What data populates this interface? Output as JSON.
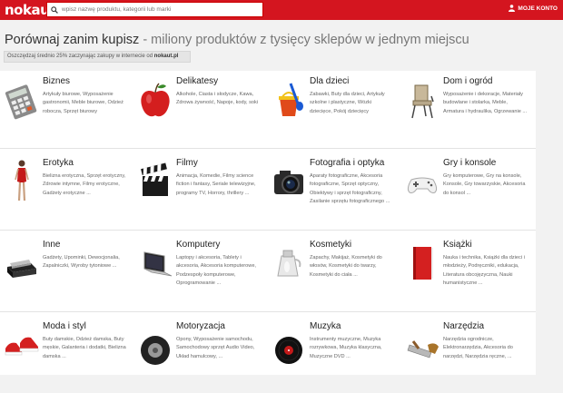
{
  "header": {
    "logo": "nokaut",
    "search_placeholder": "wpisz nazwę produktu, kategorii lub marki",
    "account_label": "MOJE KONTO"
  },
  "headline": {
    "strong": "Porównaj zanim kupisz",
    "light": " - miliony produktów z tysięcy sklepów w jednym miejscu"
  },
  "promo": {
    "text": "Oszczędzaj średnio 25% zaczynając zakupy w internecie od ",
    "brand": "nokaut.pl"
  },
  "categories": [
    {
      "title": "Biznes",
      "desc": "Artykuły biurowe, Wyposażenie gastronomii, Meble biurowe, Odzież robocza, Sprzęt biurowy",
      "icon": "calculator-icon"
    },
    {
      "title": "Delikatesy",
      "desc": "Alkohole, Ciasta i słodycze, Kawa, Zdrowa żywność, Napoje, kody, soki",
      "icon": "apple-icon"
    },
    {
      "title": "Dla dzieci",
      "desc": "Zabawki, Buty dla dzieci, Artykuły szkolne i plastyczne, Wózki dziecięce, Pokój dziecięcy",
      "icon": "bucket-toy-icon"
    },
    {
      "title": "Dom i ogród",
      "desc": "Wyposażenie i dekoracje, Materiały budowlane i stolarka, Meble, Armatura i hydraulika, Ogrzewanie ...",
      "icon": "chair-icon"
    },
    {
      "title": "Erotyka",
      "desc": "Bielizna erotyczna, Sprzęt erotyczny, Zdrowie intymne, Filmy erotyczne, Gadżety erotyczne ...",
      "icon": "woman-figure-icon"
    },
    {
      "title": "Filmy",
      "desc": "Animacja, Komedie, Filmy science fiction i fantasy, Seriale telewizyjne, programy TV, Horrory, thrillery ...",
      "icon": "film-clapper-icon"
    },
    {
      "title": "Fotografia i optyka",
      "desc": "Aparaty fotograficzne, Akcesoria fotograficzne, Sprzęt optyczny, Obiektywy i sprzęt fotograficzny, Zasilanie sprzętu fotograficznego ...",
      "icon": "camera-icon"
    },
    {
      "title": "Gry i konsole",
      "desc": "Gry komputerowe, Gry na konsole, Konsole, Gry towarzyskie, Akcesoria do konsol ...",
      "icon": "gamepad-icon"
    },
    {
      "title": "Inne",
      "desc": "Gadżety, Upominki, Dewocjonalia, Zapalniczki, Wyroby tytoniowe ...",
      "icon": "gift-box-icon"
    },
    {
      "title": "Komputery",
      "desc": "Laptopy i akcesoria, Tablety i akcesoria, Akcesoria komputerowe, Podzespoły komputerowe, Oprogramowanie ...",
      "icon": "laptop-icon"
    },
    {
      "title": "Kosmetyki",
      "desc": "Zapachy, Makijaż, Kosmetyki do włosów, Kosmetyki do twarzy, Kosmetyki do ciała ...",
      "icon": "cosmetic-jar-icon"
    },
    {
      "title": "Książki",
      "desc": "Nauka i technika, Książki dla dzieci i młodzieży, Podręczniki, edukacja, Literatura obcojęzyczna, Nauki humanistyczne ...",
      "icon": "book-icon"
    },
    {
      "title": "Moda i styl",
      "desc": "Buty damskie, Odzież damska, Buty męskie, Galanteria i dodatki, Bielizna damska ...",
      "icon": "sneakers-icon"
    },
    {
      "title": "Motoryzacja",
      "desc": "Opony, Wyposażenie samochodu, Samochodowy sprzęt Audio Video, Układ hamulcowy, ...",
      "icon": "tire-icon"
    },
    {
      "title": "Muzyka",
      "desc": "Instrumenty muzyczne, Muzyka rozrywkowa, Muzyka klasyczna, Muzyczne DVD ...",
      "icon": "vinyl-record-icon"
    },
    {
      "title": "Narzędzia",
      "desc": "Narzędzia ogrodnicze, Elektronarzędzia, Akcesoria do narzędzi, Narzędzia ręczne, ...",
      "icon": "saw-icon"
    }
  ]
}
